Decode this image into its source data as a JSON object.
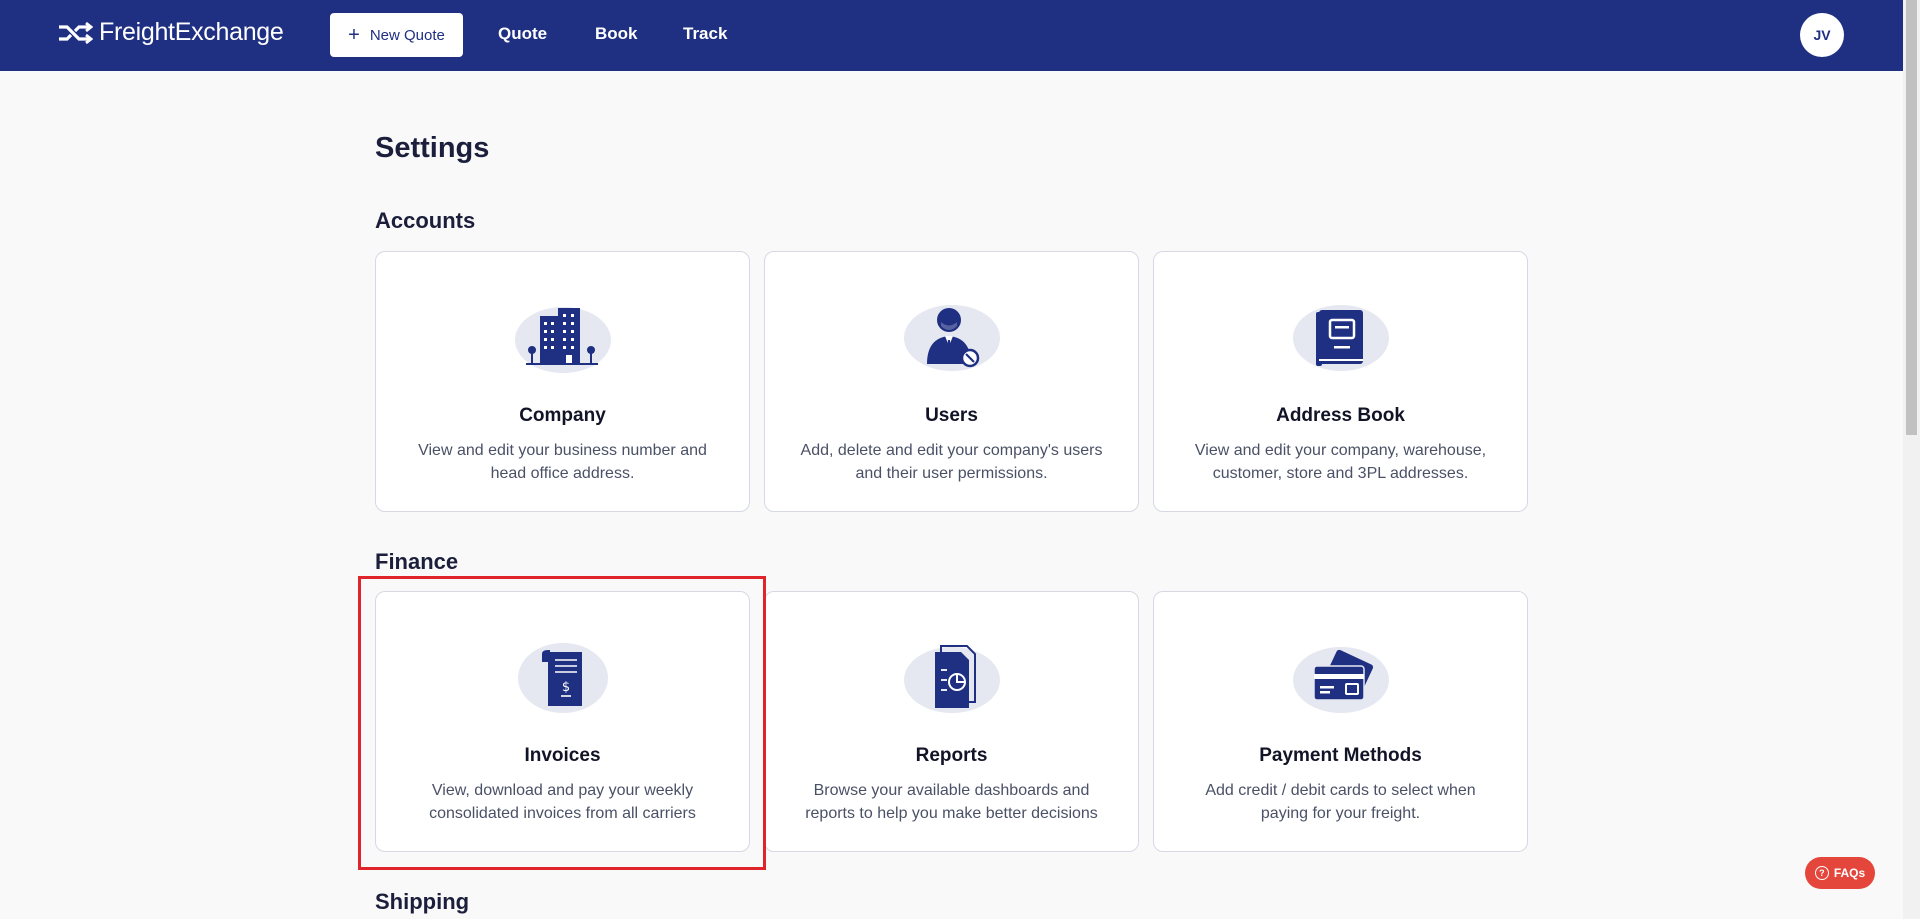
{
  "header": {
    "brand": "FreightExchange",
    "new_quote_label": "New Quote",
    "nav": [
      "Quote",
      "Book",
      "Track"
    ],
    "avatar_initials": "JV",
    "brand_color": "#1f2f82"
  },
  "page": {
    "title": "Settings"
  },
  "sections": {
    "accounts": {
      "title": "Accounts",
      "cards": [
        {
          "title": "Company",
          "description": "View and edit your business number and head office address.",
          "icon": "building-icon"
        },
        {
          "title": "Users",
          "description": "Add, delete and edit your company's users and their user permissions.",
          "icon": "user-settings-icon"
        },
        {
          "title": "Address Book",
          "description": "View and edit your company, warehouse, customer, store and 3PL addresses.",
          "icon": "address-book-icon"
        }
      ]
    },
    "finance": {
      "title": "Finance",
      "cards": [
        {
          "title": "Invoices",
          "description": "View, download and pay your weekly consolidated invoices from all carriers",
          "icon": "invoice-icon"
        },
        {
          "title": "Reports",
          "description": "Browse your available dashboards and reports to help you make better decisions",
          "icon": "report-icon"
        },
        {
          "title": "Payment Methods",
          "description": "Add credit / debit cards to select when paying for your freight.",
          "icon": "credit-card-icon"
        }
      ]
    },
    "shipping": {
      "title": "Shipping"
    }
  },
  "faq_label": "FAQs",
  "highlight_color": "#e0242b"
}
